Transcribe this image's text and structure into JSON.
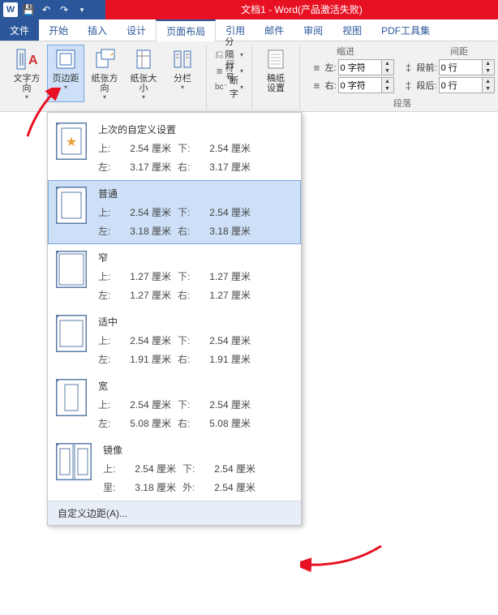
{
  "title": "文档1 - Word(产品激活失败)",
  "tabs": {
    "file": "文件",
    "home": "开始",
    "insert": "插入",
    "design": "设计",
    "layout": "页面布局",
    "references": "引用",
    "mail": "邮件",
    "review": "审阅",
    "view": "视图",
    "pdf": "PDF工具集"
  },
  "ribbon": {
    "textdir": "文字方向",
    "margins": "页边距",
    "orient": "纸张方向",
    "size": "纸张大小",
    "columns": "分栏",
    "breaks": "分隔符",
    "linenum": "行号",
    "hyphen": "断字",
    "gaozhi": "稿纸",
    "gaozhi2": "设置",
    "indent_title": "缩进",
    "spacing_title": "间距",
    "left": "左:",
    "right": "右:",
    "before": "段前:",
    "after": "段后:",
    "left_val": "0 字符",
    "right_val": "0 字符",
    "before_val": "0 行",
    "after_val": "0 行",
    "para_group": "段落"
  },
  "dropdown": {
    "last": "上次的自定义设置",
    "normal": "普通",
    "narrow": "窄",
    "moderate": "适中",
    "wide": "宽",
    "mirror": "镜像",
    "top": "上:",
    "bottom": "下:",
    "left": "左:",
    "right": "右:",
    "inside": "里:",
    "outside": "外:",
    "presets": [
      {
        "name": "last",
        "t": "2.54 厘米",
        "b": "2.54 厘米",
        "l": "3.17 厘米",
        "r": "3.17 厘米"
      },
      {
        "name": "normal",
        "t": "2.54 厘米",
        "b": "2.54 厘米",
        "l": "3.18 厘米",
        "r": "3.18 厘米"
      },
      {
        "name": "narrow",
        "t": "1.27 厘米",
        "b": "1.27 厘米",
        "l": "1.27 厘米",
        "r": "1.27 厘米"
      },
      {
        "name": "moderate",
        "t": "2.54 厘米",
        "b": "2.54 厘米",
        "l": "1.91 厘米",
        "r": "1.91 厘米"
      },
      {
        "name": "wide",
        "t": "2.54 厘米",
        "b": "2.54 厘米",
        "l": "5.08 厘米",
        "r": "5.08 厘米"
      },
      {
        "name": "mirror",
        "t": "2.54 厘米",
        "b": "2.54 厘米",
        "l": "3.18 厘米",
        "r": "2.54 厘米"
      }
    ],
    "custom": "自定义边距(A)..."
  }
}
